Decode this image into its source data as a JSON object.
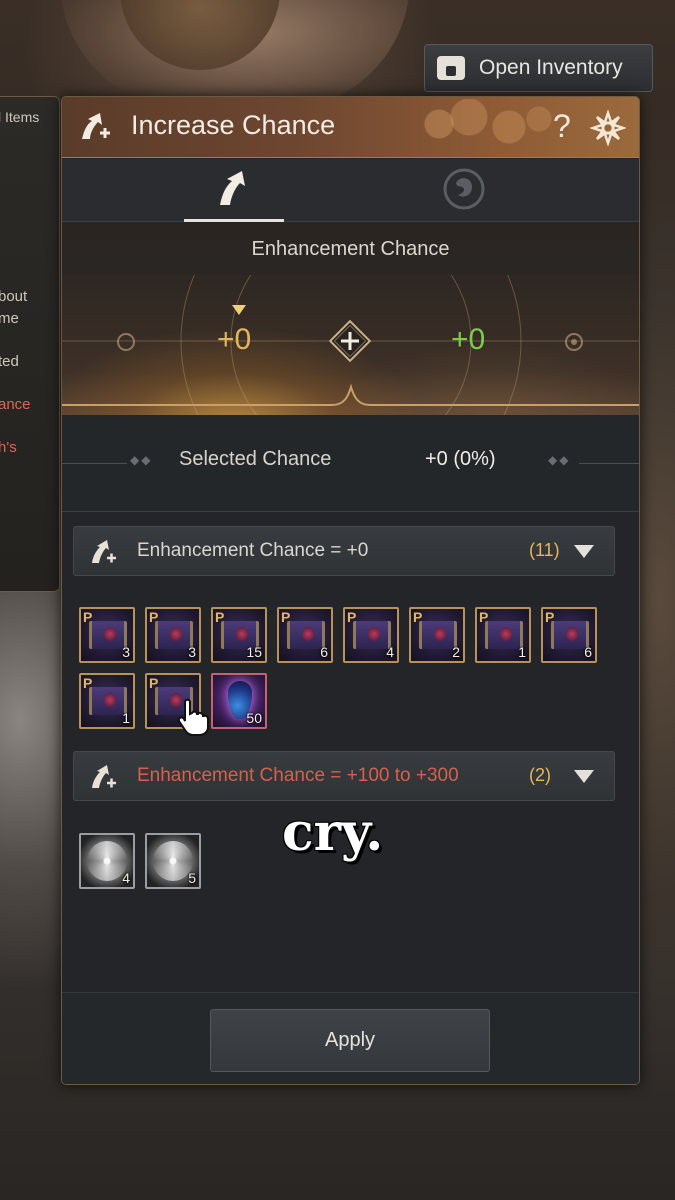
{
  "left_panel": {
    "items": [
      {
        "text": "l Items",
        "style": "normal"
      },
      {
        "text": "bout",
        "style": "normal"
      },
      {
        "text": "me",
        "style": "normal"
      },
      {
        "text": "ted",
        "style": "normal"
      },
      {
        "text": "ance",
        "style": "red"
      },
      {
        "text": "h's",
        "style": "red"
      }
    ]
  },
  "inventory_button": {
    "label": "Open Inventory",
    "icon": "inventory-bag-icon"
  },
  "window": {
    "title": "Increase Chance",
    "help_label": "?",
    "tabs": [
      {
        "icon": "enhance-arrow-icon",
        "active": true
      },
      {
        "icon": "crystal-orb-icon",
        "active": false
      }
    ],
    "section_title": "Enhancement Chance",
    "chance_left": "+0",
    "chance_right": "+0",
    "selected_label": "Selected Chance",
    "selected_value": "+0 (0%)",
    "groups": [
      {
        "label": "Enhancement Chance = +0",
        "count": "(11)",
        "label_color": "#dad6cf",
        "items": [
          {
            "type": "scroll",
            "badge": "P",
            "qty": "3"
          },
          {
            "type": "scroll",
            "badge": "P",
            "qty": "3"
          },
          {
            "type": "scroll",
            "badge": "P",
            "qty": "15"
          },
          {
            "type": "scroll",
            "badge": "P",
            "qty": "6"
          },
          {
            "type": "scroll",
            "badge": "P",
            "qty": "4"
          },
          {
            "type": "scroll",
            "badge": "P",
            "qty": "2"
          },
          {
            "type": "scroll",
            "badge": "P",
            "qty": "1"
          },
          {
            "type": "scroll",
            "badge": "P",
            "qty": "6"
          },
          {
            "type": "scroll",
            "badge": "P",
            "qty": "1"
          },
          {
            "type": "scroll",
            "badge": "P",
            "qty": ""
          },
          {
            "type": "gem",
            "badge": "",
            "qty": "50"
          }
        ]
      },
      {
        "label": "Enhancement Chance = +100 to +300",
        "count": "(2)",
        "label_color": "#d7604b",
        "items": [
          {
            "type": "stone",
            "badge": "",
            "qty": "4"
          },
          {
            "type": "stone",
            "badge": "",
            "qty": "5"
          }
        ]
      }
    ],
    "apply_label": "Apply"
  },
  "caption": "cry.",
  "colors": {
    "accent_gold": "#e3b55d",
    "positive_green": "#7bcb4c",
    "warning_red": "#d7604b",
    "title_bar": "#8e5b35"
  }
}
